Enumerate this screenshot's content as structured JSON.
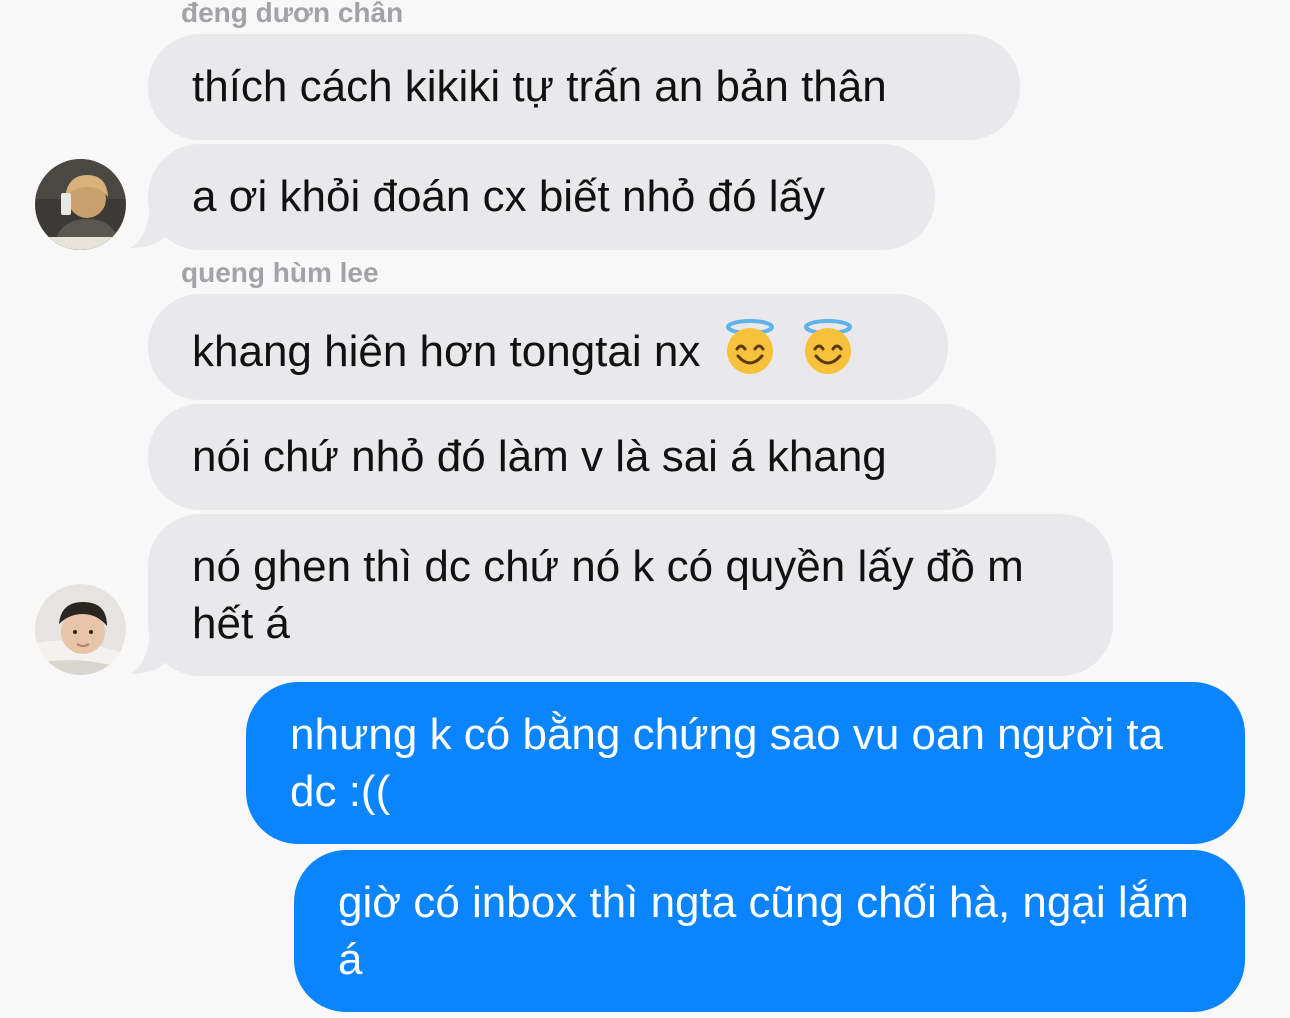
{
  "senders": {
    "first": "đeng dươn chân",
    "second": "queng hùm lee"
  },
  "messages": [
    {
      "text": "thích cách kikiki tự trấn an bản thân",
      "direction": "incoming"
    },
    {
      "text": "a ơi khỏi đoán cx biết nhỏ đó lấy",
      "direction": "incoming"
    },
    {
      "text": "khang hiên hơn tongtai nx",
      "emoji": [
        "smiling-face-with-halo",
        "smiling-face-with-halo"
      ],
      "direction": "incoming"
    },
    {
      "text": "nói chứ nhỏ đó làm v là sai á khang",
      "direction": "incoming"
    },
    {
      "text": "nó ghen thì dc chứ nó k có quyền lấy đồ m hết á",
      "direction": "incoming"
    },
    {
      "text": "nhưng k có bằng chứng sao vu oan người ta dc :((",
      "direction": "outgoing"
    },
    {
      "text": "giờ có inbox thì ngta cũng chối hà, ngại lắm á",
      "direction": "outgoing"
    }
  ],
  "colors": {
    "incoming_bubble": "#e9e9eb",
    "outgoing_bubble": "#0a84ff",
    "sender_label": "#a2a2a7",
    "background": "#f8f8f8"
  }
}
